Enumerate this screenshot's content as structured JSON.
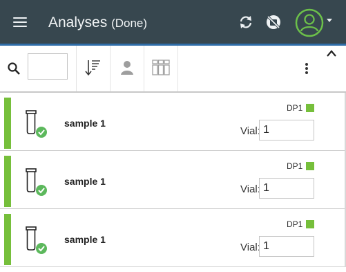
{
  "header": {
    "title": "Analyses",
    "subtitle": "(Done)",
    "icons": [
      "menu-icon",
      "sync-icon",
      "offline-icon",
      "user-avatar-icon",
      "chevron-down-icon"
    ],
    "bg_color": "#37474f",
    "accent_color": "#2f6da8"
  },
  "toolbar": {
    "search_value": "",
    "icons": [
      "search-icon",
      "sort-icon",
      "user-icon",
      "columns-icon",
      "more-vertical-icon",
      "chevron-up-icon"
    ]
  },
  "samples": [
    {
      "name": "sample 1",
      "dp": "DP1",
      "vial_label": "Vial:",
      "vial": "1",
      "status": "done"
    },
    {
      "name": "sample 1",
      "dp": "DP1",
      "vial_label": "Vial:",
      "vial": "1",
      "status": "done"
    },
    {
      "name": "sample 1",
      "dp": "DP1",
      "vial_label": "Vial:",
      "vial": "1",
      "status": "done"
    }
  ],
  "colors": {
    "status_green": "#76bf3b",
    "check_green": "#5cb85c"
  }
}
